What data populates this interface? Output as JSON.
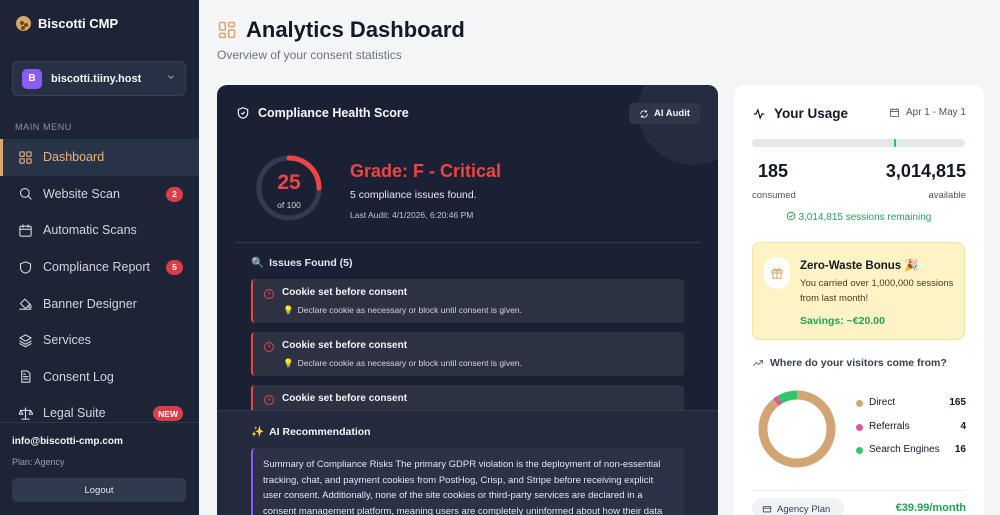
{
  "sidebar": {
    "brand": "Biscotti CMP",
    "site": {
      "initial": "B",
      "name": "biscotti.tiiny.host"
    },
    "menu_label": "MAIN MENU",
    "items": [
      {
        "label": "Dashboard",
        "icon": "grid-icon",
        "active": true
      },
      {
        "label": "Website Scan",
        "icon": "search-icon",
        "badge": "2"
      },
      {
        "label": "Automatic Scans",
        "icon": "calendar-icon"
      },
      {
        "label": "Compliance Report",
        "icon": "shield-icon",
        "badge": "5"
      },
      {
        "label": "Banner Designer",
        "icon": "paint-bucket-icon"
      },
      {
        "label": "Services",
        "icon": "layers-icon"
      },
      {
        "label": "Consent Log",
        "icon": "file-text-icon"
      },
      {
        "label": "Legal Suite",
        "icon": "scale-icon",
        "badge": "NEW"
      }
    ],
    "user": {
      "email": "info@biscotti-cmp.com",
      "plan": "Plan: Agency",
      "logout": "Logout"
    }
  },
  "header": {
    "title": "Analytics Dashboard",
    "subtitle": "Overview of your consent statistics"
  },
  "health": {
    "title": "Compliance Health Score",
    "audit_button": "AI Audit",
    "score": "25",
    "score_max": "of 100",
    "score_fraction": 0.25,
    "grade": "Grade: F - Critical",
    "issues_count_text": "5 compliance issues found.",
    "last_audit": "Last Audit: 4/1/2026, 6:20:46 PM",
    "issues_header": "Issues Found (5)",
    "issues": [
      {
        "title": "Cookie set before consent",
        "hint": "Declare cookie as necessary or block until consent is given."
      },
      {
        "title": "Cookie set before consent",
        "hint": "Declare cookie as necessary or block until consent is given."
      },
      {
        "title": "Cookie set before consent",
        "hint": ""
      }
    ],
    "ai_title": "AI Recommendation",
    "ai_text": "Summary of Compliance Risks The primary GDPR violation is the deployment of non-essential tracking, chat, and payment cookies from PostHog, Crisp, and Stripe before receiving explicit user consent. Additionally, none of the site cookies or third-party services are declared in a consent management platform, meaning users are completely uninformed about how their data"
  },
  "usage": {
    "title": "Your Usage",
    "date_range": "Apr 1 - May 1",
    "consumed": "185",
    "consumed_label": "consumed",
    "available": "3,014,815",
    "available_label": "available",
    "usage_fraction": 0.0001,
    "remaining": "3,014,815 sessions remaining",
    "bonus": {
      "title": "Zero-Waste Bonus 🎉",
      "text": "You carried over 1,000,000 sessions from last month!",
      "savings": "Savings: ~€20.00"
    },
    "visitors_title": "Where do your visitors come from?",
    "sources": [
      {
        "name": "Direct",
        "value": 165,
        "color": "#d4a574"
      },
      {
        "name": "Referrals",
        "value": 4,
        "color": "#e0559a"
      },
      {
        "name": "Search Engines",
        "value": 16,
        "color": "#34c46a"
      }
    ],
    "plan_name": "Agency Plan",
    "plan_price": "€39.99/month"
  },
  "colors": {
    "accent": "#d7a66b",
    "danger": "#ef4444",
    "success": "#22a355",
    "sidebar": "#1c2436"
  }
}
